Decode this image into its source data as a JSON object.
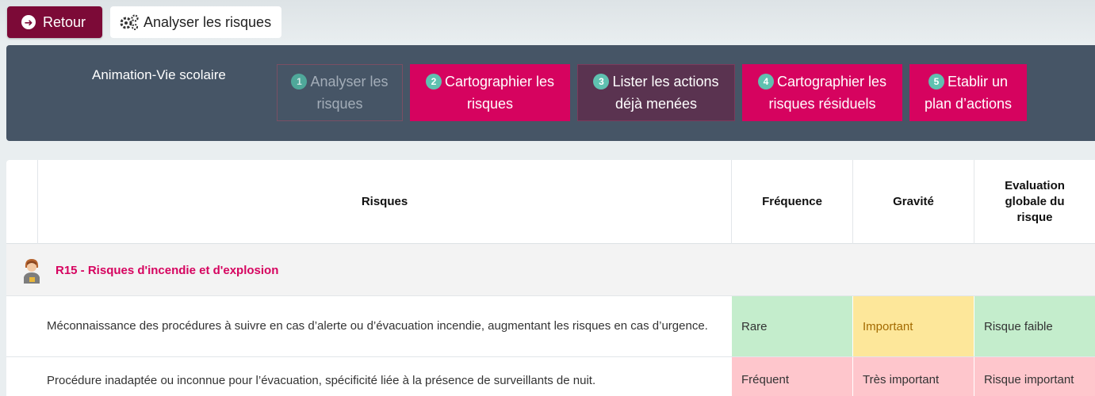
{
  "toolbar": {
    "back_label": "Retour",
    "page_title": "Analyser les risques"
  },
  "stepbar": {
    "school": "Animation-Vie scolaire",
    "steps": [
      {
        "num": "1",
        "line1": "Analyser les",
        "line2": "risques"
      },
      {
        "num": "2",
        "line1": "Cartographier les",
        "line2": "risques"
      },
      {
        "num": "3",
        "line1": "Lister les actions",
        "line2": "déjà menées"
      },
      {
        "num": "4",
        "line1": "Cartographier les",
        "line2": "risques résiduels"
      },
      {
        "num": "5",
        "line1": "Etablir un",
        "line2": "plan d’actions"
      }
    ]
  },
  "table": {
    "headers": {
      "risk": "Risques",
      "frequency": "Fréquence",
      "severity": "Gravité",
      "evaluation_l1": "Evaluation",
      "evaluation_l2": "globale du",
      "evaluation_l3": "risque"
    },
    "group": {
      "label": "R15 - Risques d'incendie et d'explosion"
    },
    "rows": [
      {
        "desc": "Méconnaissance des procédures à suivre en cas d’alerte ou d’évacuation incendie, augmentant les risques en cas d’urgence.",
        "frequency": "Rare",
        "severity": "Important",
        "evaluation": "Risque faible"
      },
      {
        "desc": "Procédure inadaptée ou inconnue pour l’évacuation, spécificité liée à la présence de surveillants de nuit.",
        "frequency": "Fréquent",
        "severity": "Très important",
        "evaluation": "Risque important"
      }
    ]
  },
  "colors": {
    "accent": "#d6035f",
    "back_button": "#7c0a37",
    "stepbar": "#465566",
    "low": "#c4edcc",
    "medium": "#fde79a",
    "high": "#fec6cc"
  },
  "icons": [
    "arrow-left-circle-icon",
    "gears-icon",
    "worker-avatar-icon"
  ]
}
